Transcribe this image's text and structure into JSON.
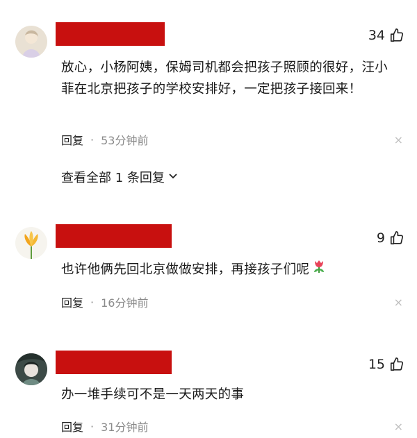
{
  "comments": [
    {
      "likes": "34",
      "text": "放心，小杨阿姨，保姆司机都会把孩子照顾的很好，汪小菲在北京把孩子的学校安排好，一定把孩子接回来！",
      "reply_label": "回复",
      "separator": "·",
      "time": "53分钟前",
      "close": "×",
      "view_replies": "查看全部 1 条回复"
    },
    {
      "likes": "9",
      "text": "也许他俩先回北京做做安排，再接孩子们呢",
      "reply_label": "回复",
      "separator": "·",
      "time": "16分钟前",
      "close": "×"
    },
    {
      "likes": "15",
      "text": "办一堆手续可不是一天两天的事",
      "reply_label": "回复",
      "separator": "·",
      "time": "31分钟前",
      "close": "×"
    }
  ],
  "icons": {
    "like": "thumbs-up-icon",
    "chevron": "chevron-down-icon",
    "emoji": "tulip-emoji-icon"
  },
  "colors": {
    "name_redaction": "#c8100f",
    "meta_gray": "#8a8a8a"
  }
}
